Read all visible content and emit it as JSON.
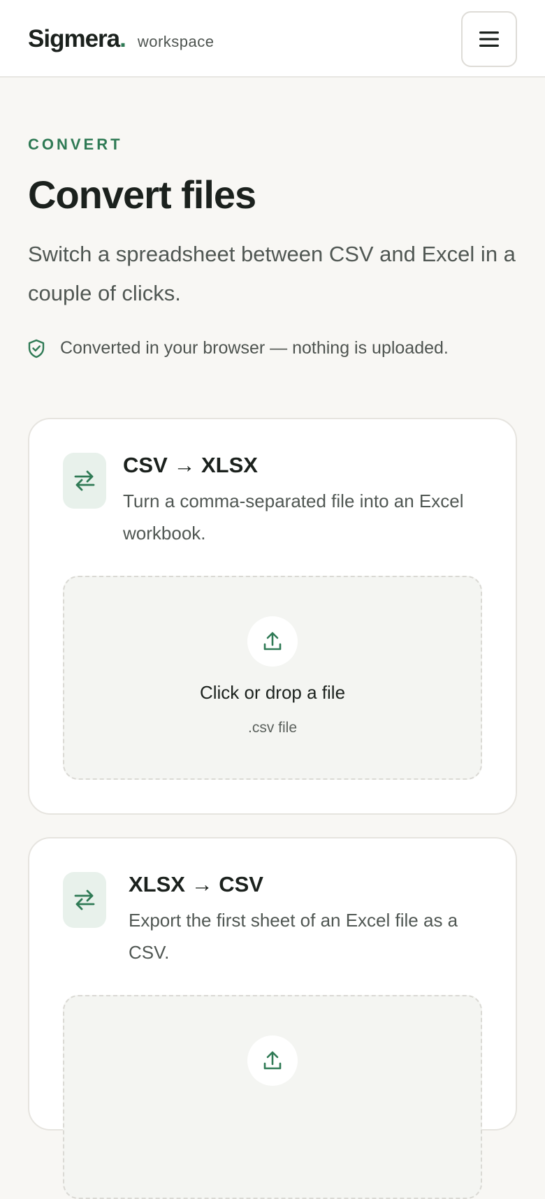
{
  "header": {
    "brand": "Sigmera",
    "brand_dot": ".",
    "brand_sub": "workspace",
    "menu_icon": "hamburger-icon"
  },
  "hero": {
    "eyebrow": "CONVERT",
    "title": "Convert files",
    "lede": "Switch a spreadsheet between CSV and Excel in a couple of clicks.",
    "privacy_icon": "shield-check-icon",
    "privacy_note": "Converted in your browser — nothing is uploaded."
  },
  "converters": [
    {
      "icon": "swap-arrows-icon",
      "title": "CSV → XLSX",
      "description": "Turn a comma-separated file into an Excel workbook.",
      "dropzone": {
        "icon": "upload-icon",
        "label": "Click or drop a file",
        "hint": ".csv file"
      }
    },
    {
      "icon": "swap-arrows-icon",
      "title": "XLSX → CSV",
      "description": "Export the first sheet of an Excel file as a CSV.",
      "dropzone": {
        "icon": "upload-icon"
      }
    }
  ],
  "colors": {
    "accent": "#2f7a55",
    "background": "#f8f7f4",
    "card": "#ffffff",
    "icon_tile": "#e8f1eb",
    "dropzone": "#f4f5f2",
    "text": "#1b211d",
    "muted_text": "#505753"
  }
}
